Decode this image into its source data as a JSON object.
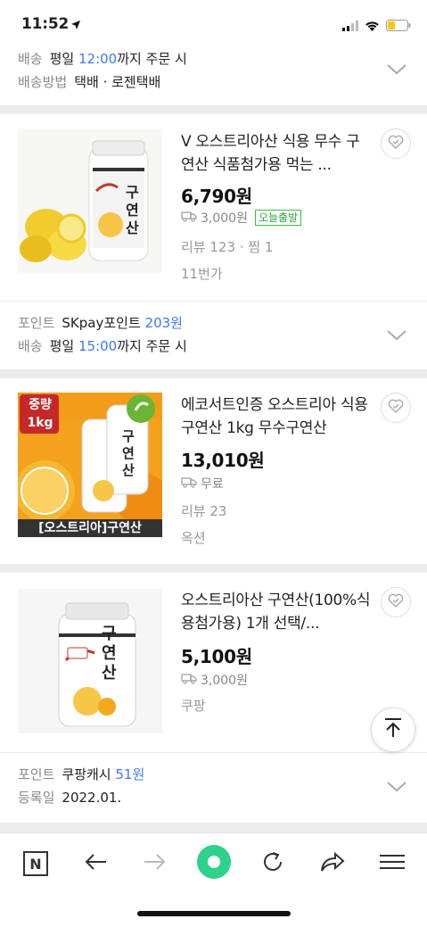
{
  "status_bar": {
    "time": "11:52"
  },
  "top_meta": {
    "delivery_key": "배송",
    "delivery_day": "평일",
    "delivery_time": "12:00",
    "delivery_suffix": "까지 주문 시",
    "method_key": "배송방법",
    "method_value": "택배 · 로젠택배"
  },
  "products": [
    {
      "title": "V 오스트리아산 식용 무수 구연산 식품첨가용 먹는 ...",
      "price": "6,790원",
      "shipping": "3,000원",
      "badge": "오늘출발",
      "review": "리뷰 123 · 찜 1",
      "store": "11번가",
      "thumb_label": "구연산"
    },
    {
      "title": "에코서트인증 오스트리아 식용구연산 1kg 무수구연산",
      "price": "13,010원",
      "shipping": "무료",
      "review": "리뷰 23",
      "store": "옥션",
      "thumb_label": "구연산",
      "thumb_tag": "중량 1kg",
      "thumb_caption": "[오스트리아]구연산"
    },
    {
      "title": "오스트리아산 구연산(100%식용첨가용) 1개 선택/...",
      "price": "5,100원",
      "shipping": "3,000원",
      "store": "쿠팡",
      "thumb_label": "구연산"
    }
  ],
  "meta_1": {
    "point_key": "포인트",
    "point_name": "SKpay포인트",
    "point_value": "203원",
    "delivery_key": "배송",
    "delivery_day": "평일",
    "delivery_time": "15:00",
    "delivery_suffix": "까지 주문 시"
  },
  "meta_3": {
    "point_key": "포인트",
    "point_name": "쿠팡캐시",
    "point_value": "51원",
    "date_key": "등록일",
    "date_value": "2022.01."
  },
  "toolbar": {
    "n_label": "N"
  },
  "colors": {
    "accent_blue": "#3a7bf5",
    "badge_green": "#3fb74a",
    "record_green": "#2fd28a"
  }
}
